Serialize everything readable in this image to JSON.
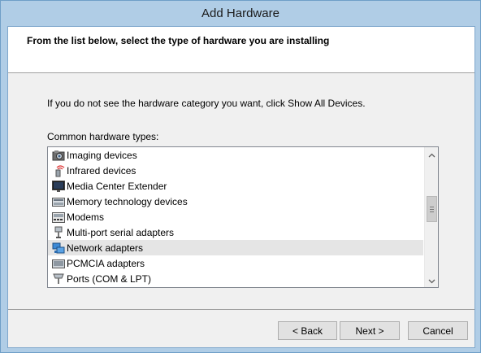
{
  "window": {
    "title": "Add Hardware"
  },
  "header": {
    "instruction": "From the list below, select the type of hardware you are installing"
  },
  "main": {
    "hint": "If you do not see the hardware category you want, click Show All Devices.",
    "list_label": "Common hardware types:"
  },
  "hardware_list": {
    "items": [
      {
        "label": "Imaging devices",
        "icon": "camera-icon"
      },
      {
        "label": "Infrared devices",
        "icon": "infrared-icon"
      },
      {
        "label": "Media Center Extender",
        "icon": "monitor-icon"
      },
      {
        "label": "Memory technology devices",
        "icon": "memory-card-icon"
      },
      {
        "label": "Modems",
        "icon": "modem-icon"
      },
      {
        "label": "Multi-port serial adapters",
        "icon": "serial-port-icon"
      },
      {
        "label": "Network adapters",
        "icon": "network-adapter-icon",
        "selected": true
      },
      {
        "label": "PCMCIA adapters",
        "icon": "pcmcia-card-icon"
      },
      {
        "label": "Ports (COM & LPT)",
        "icon": "port-plug-icon"
      }
    ]
  },
  "buttons": {
    "back": "< Back",
    "next": "Next >",
    "cancel": "Cancel"
  },
  "colors": {
    "titlebar": "#b0cde6",
    "selection": "#e5e5e5"
  }
}
